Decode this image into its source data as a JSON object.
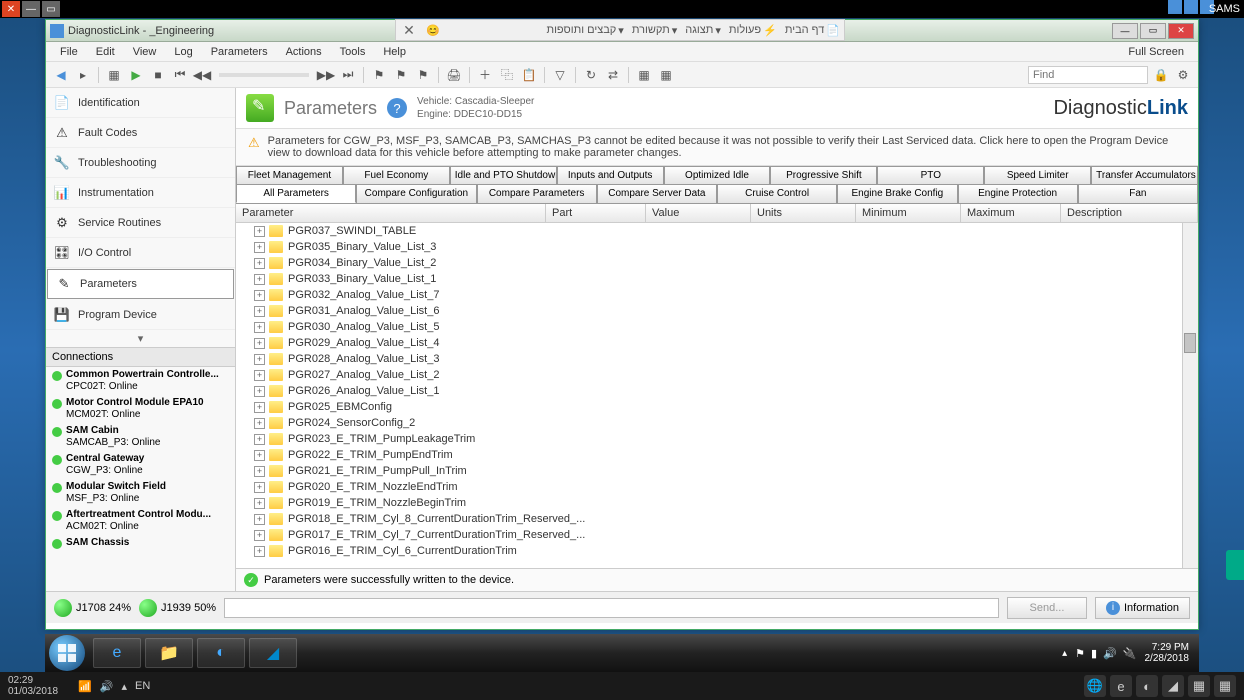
{
  "os_top": {
    "sams": "SAMS"
  },
  "window": {
    "title": "DiagnosticLink - _Engineering"
  },
  "menubar": [
    "File",
    "Edit",
    "View",
    "Log",
    "Parameters",
    "Actions",
    "Tools",
    "Help"
  ],
  "fullscreen_label": "Full Screen",
  "find_placeholder": "Find",
  "hebrew_tabs": [
    "דף הבית",
    "פעולות",
    "תצוגה",
    "תקשורת",
    "קבצים ותוספות"
  ],
  "sidebar": {
    "items": [
      {
        "label": "Identification",
        "icon": "📄"
      },
      {
        "label": "Fault Codes",
        "icon": "⚠"
      },
      {
        "label": "Troubleshooting",
        "icon": "🔧"
      },
      {
        "label": "Instrumentation",
        "icon": "📊"
      },
      {
        "label": "Service Routines",
        "icon": "⚙"
      },
      {
        "label": "I/O Control",
        "icon": "🎛"
      },
      {
        "label": "Parameters",
        "icon": "✎",
        "active": true
      },
      {
        "label": "Program Device",
        "icon": "💾"
      }
    ],
    "connections_header": "Connections",
    "connections": [
      {
        "name": "Common Powertrain Controlle...",
        "sub": "CPC02T: Online"
      },
      {
        "name": "Motor Control Module EPA10",
        "sub": "MCM02T: Online"
      },
      {
        "name": "SAM Cabin",
        "sub": "SAMCAB_P3: Online"
      },
      {
        "name": "Central Gateway",
        "sub": "CGW_P3: Online"
      },
      {
        "name": "Modular Switch Field",
        "sub": "MSF_P3: Online"
      },
      {
        "name": "Aftertreatment Control Modu...",
        "sub": "ACM02T: Online"
      },
      {
        "name": "SAM Chassis",
        "sub": ""
      }
    ]
  },
  "main": {
    "title": "Parameters",
    "vehicle": "Vehicle: Cascadia-Sleeper",
    "engine": "Engine: DDEC10-DD15",
    "brand_pre": "Diagnostic",
    "brand_bold": "Link",
    "warning": "Parameters for CGW_P3, MSF_P3, SAMCAB_P3, SAMCHAS_P3 cannot be edited because it was not possible to verify their Last Serviced data. Click here to open the Program Device view to download data for this vehicle before attempting to make parameter changes.",
    "tab_row1": [
      "Fleet Management",
      "Fuel Economy",
      "Idle and PTO Shutdown",
      "Inputs and Outputs",
      "Optimized Idle",
      "Progressive Shift",
      "PTO",
      "Speed Limiter",
      "Transfer Accumulators"
    ],
    "tab_row2": [
      "All Parameters",
      "Compare Configuration",
      "Compare Parameters",
      "Compare Server Data",
      "Cruise Control",
      "Engine Brake Config",
      "Engine Protection",
      "Fan"
    ],
    "columns": [
      "Parameter",
      "Part",
      "Value",
      "Units",
      "Minimum",
      "Maximum",
      "Description"
    ],
    "rows": [
      "PGR016_E_TRIM_Cyl_6_CurrentDurationTrim",
      "PGR017_E_TRIM_Cyl_7_CurrentDurationTrim_Reserved_...",
      "PGR018_E_TRIM_Cyl_8_CurrentDurationTrim_Reserved_...",
      "PGR019_E_TRIM_NozzleBeginTrim",
      "PGR020_E_TRIM_NozzleEndTrim",
      "PGR021_E_TRIM_PumpPull_InTrim",
      "PGR022_E_TRIM_PumpEndTrim",
      "PGR023_E_TRIM_PumpLeakageTrim",
      "PGR024_SensorConfig_2",
      "PGR025_EBMConfig",
      "PGR026_Analog_Value_List_1",
      "PGR027_Analog_Value_List_2",
      "PGR028_Analog_Value_List_3",
      "PGR029_Analog_Value_List_4",
      "PGR030_Analog_Value_List_5",
      "PGR031_Analog_Value_List_6",
      "PGR032_Analog_Value_List_7",
      "PGR033_Binary_Value_List_1",
      "PGR034_Binary_Value_List_2",
      "PGR035_Binary_Value_List_3",
      "PGR037_SWINDI_TABLE"
    ],
    "status": "Parameters were successfully written to the device."
  },
  "bottom": {
    "j1708": "J1708 24%",
    "j1939": "J1939 50%",
    "send": "Send...",
    "info": "Information"
  },
  "taskbar": {
    "time": "7:29 PM",
    "date": "2/28/2018"
  },
  "strip": {
    "time": "02:29",
    "date": "01/03/2018",
    "lang": "EN"
  }
}
